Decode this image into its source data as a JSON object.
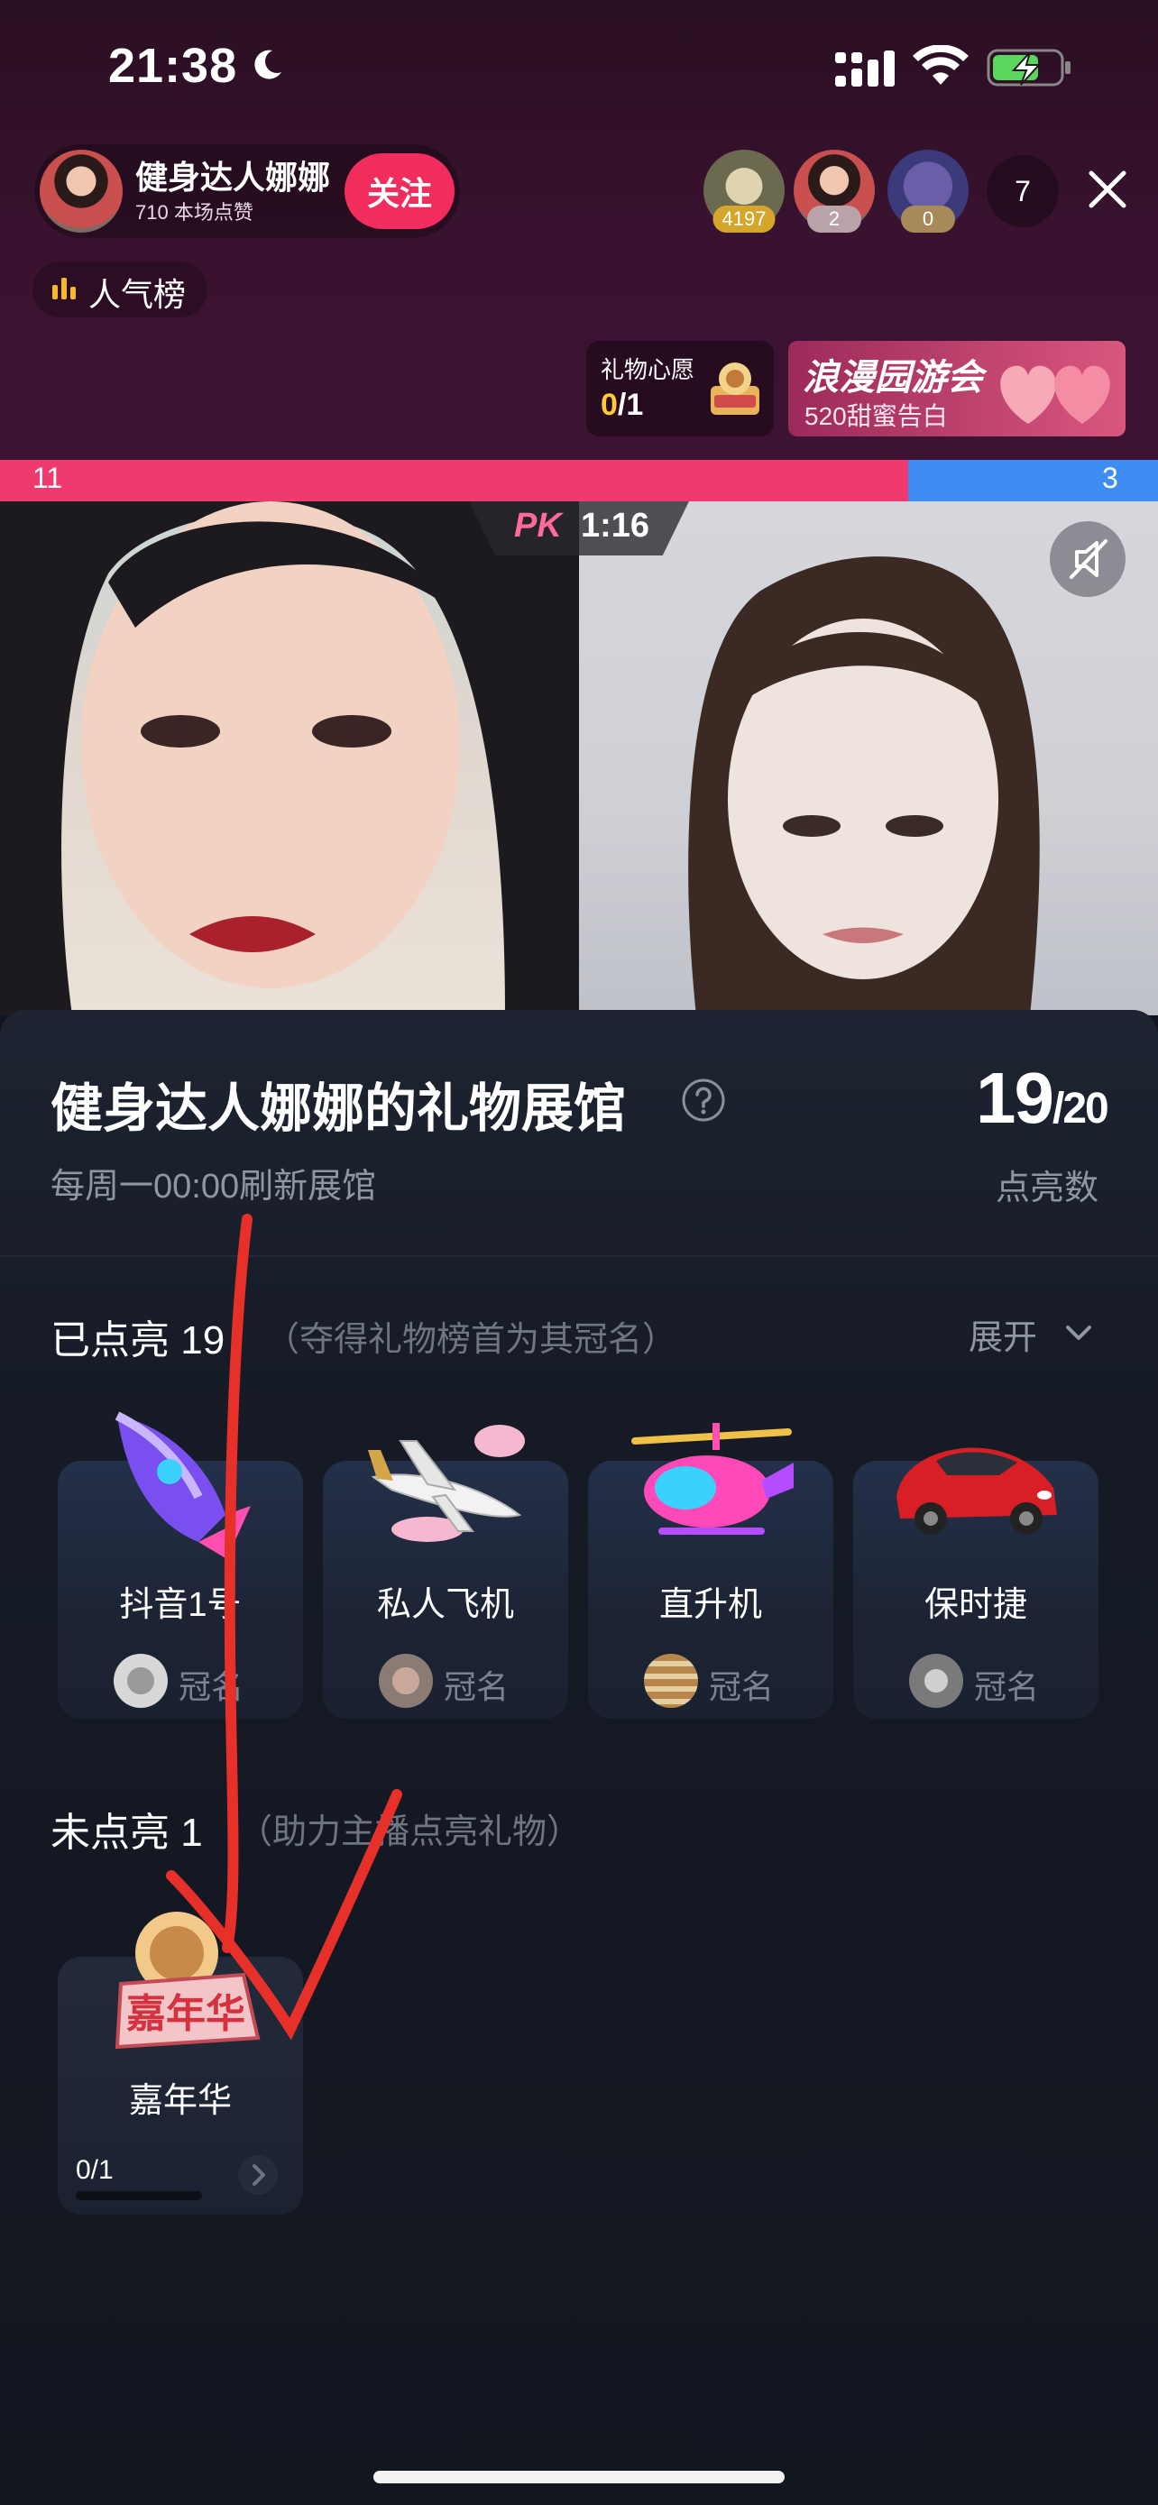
{
  "status_bar": {
    "time": "21:38"
  },
  "host": {
    "name": "健身达人娜娜",
    "likes": "710 本场点赞",
    "follow_label": "关注"
  },
  "viewers": [
    {
      "badge": "4197"
    },
    {
      "badge": "2"
    },
    {
      "badge": "0"
    }
  ],
  "viewer_count": "7",
  "rank_label": "人气榜",
  "wish": {
    "title": "礼物心愿",
    "done": "0",
    "total": "/1"
  },
  "event_banner": {
    "title": "浪漫园游会",
    "subtitle": "520甜蜜告白"
  },
  "pk": {
    "left_score": "11",
    "right_score": "3",
    "logo": "PK",
    "timer": "1:16",
    "left_share": 0.784
  },
  "gallery": {
    "title": "健身达人娜娜的礼物展馆",
    "refresh": "每周一00:00刷新展馆",
    "score_current": "19",
    "score_total": "/20",
    "score_label": "点亮数",
    "lit_label": "已点亮 19",
    "lit_hint": "（夺得礼物榜首为其冠名）",
    "expand_label": "展开",
    "lit_gifts": [
      {
        "name": "抖音1号",
        "crown": "冠名"
      },
      {
        "name": "私人飞机",
        "crown": "冠名"
      },
      {
        "name": "直升机",
        "crown": "冠名"
      },
      {
        "name": "保时捷",
        "crown": "冠名"
      }
    ],
    "unlit_label": "未点亮 1",
    "unlit_hint": "（助力主播点亮礼物）",
    "unlit_gifts": [
      {
        "name": "嘉年华",
        "progress": "0/1",
        "art_text": "嘉年华"
      }
    ]
  },
  "colors": {
    "accent": "#f02d5c",
    "pk_blue": "#3e8df3",
    "annotation": "#e8302a"
  }
}
